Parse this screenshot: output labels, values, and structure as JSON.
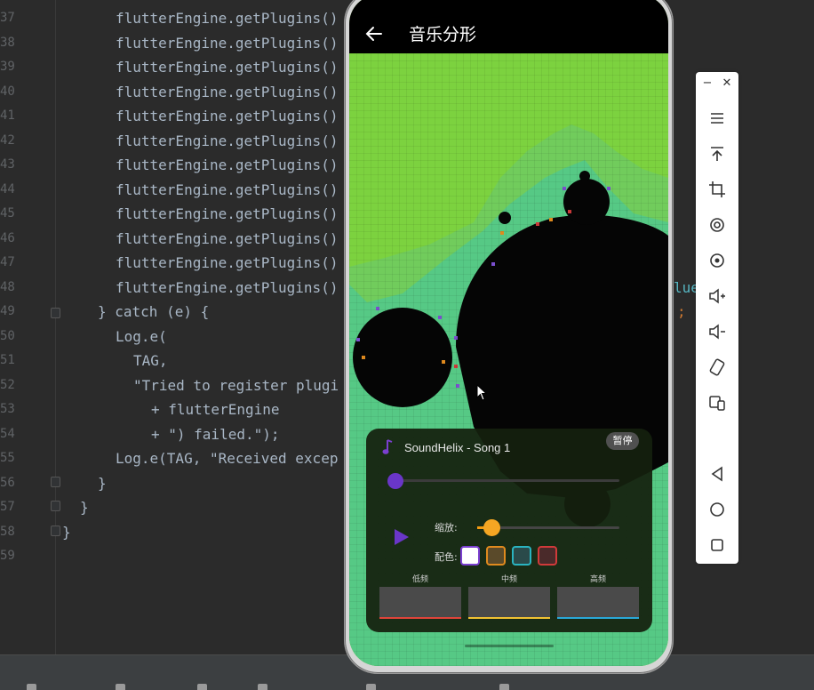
{
  "editor": {
    "lines": [
      {
        "no": "37",
        "text": "flutterEngine.getPlugins()"
      },
      {
        "no": "38",
        "text": "flutterEngine.getPlugins()"
      },
      {
        "no": "39",
        "text": "flutterEngine.getPlugins()"
      },
      {
        "no": "40",
        "text": "flutterEngine.getPlugins()"
      },
      {
        "no": "41",
        "text": "flutterEngine.getPlugins()"
      },
      {
        "no": "42",
        "text": "flutterEngine.getPlugins()"
      },
      {
        "no": "43",
        "text": "flutterEngine.getPlugins()"
      },
      {
        "no": "44",
        "text": "flutterEngine.getPlugins()"
      },
      {
        "no": "45",
        "text": "flutterEngine.getPlugins()"
      },
      {
        "no": "46",
        "text": "flutterEngine.getPlugins()"
      },
      {
        "no": "47",
        "text": "flutterEngine.getPlugins()"
      },
      {
        "no": "48",
        "text": "flutterEngine.getPlugins()"
      },
      {
        "no": "49",
        "text": "} catch (e) {"
      },
      {
        "no": "50",
        "text": "Log.e("
      },
      {
        "no": "51",
        "text": "TAG,"
      },
      {
        "no": "52",
        "text": "\"Tried to register plugi"
      },
      {
        "no": "53",
        "text": "+ flutterEngine"
      },
      {
        "no": "54",
        "text": "+ \") failed.\");"
      },
      {
        "no": "55",
        "text": "Log.e(TAG, \"Received excep"
      },
      {
        "no": "56",
        "text": "}"
      },
      {
        "no": "57",
        "text": "}"
      },
      {
        "no": "58",
        "text": "}"
      },
      {
        "no": "59",
        "text": ""
      }
    ],
    "overflow_right_1": "lue);",
    "overflow_right_2": ";"
  },
  "app": {
    "title": "音乐分形",
    "song_title": "SoundHelix - Song 1",
    "pause_label": "暂停",
    "progress": 0.0,
    "zoom_label": "缩放:",
    "zoom_value": 0.1,
    "color_label": "配色:",
    "swatches": [
      {
        "name": "white",
        "fill": "#ffffff",
        "border": "#7b3fd0"
      },
      {
        "name": "orange",
        "fill": "#5a4a2a",
        "border": "#e08a1e"
      },
      {
        "name": "teal",
        "fill": "#2a4a4a",
        "border": "#2ab3c0"
      },
      {
        "name": "red",
        "fill": "#4a2a2a",
        "border": "#d03a3a"
      }
    ],
    "bands": [
      {
        "label": "低频",
        "color": "#e0443a"
      },
      {
        "label": "中频",
        "color": "#f1c232"
      },
      {
        "label": "高频",
        "color": "#2aa8d8"
      }
    ]
  },
  "colors": {
    "fractal_bg": "#7cd23f",
    "fractal_body": "#050505",
    "accent_purple": "#6a36c8",
    "accent_orange": "#f5a623"
  }
}
